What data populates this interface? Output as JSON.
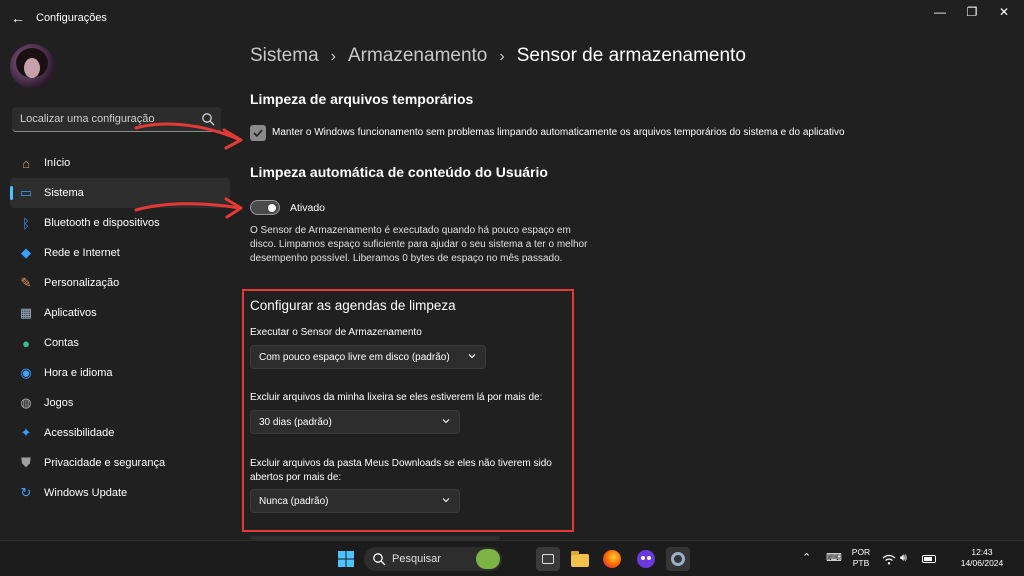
{
  "window": {
    "back_icon": "back-arrow-icon",
    "title": "Configurações",
    "controls": [
      "minimize-icon",
      "maximize-icon",
      "close-icon"
    ]
  },
  "sidebar": {
    "search_placeholder": "Localizar uma configuração",
    "items": [
      {
        "label": "Início",
        "icon": "home-icon",
        "color": "#e8a05c",
        "active": false
      },
      {
        "label": "Sistema",
        "icon": "monitor-icon",
        "color": "#3aa0ff",
        "active": true
      },
      {
        "label": "Bluetooth e dispositivos",
        "icon": "bluetooth-icon",
        "color": "#3aa0ff",
        "active": false
      },
      {
        "label": "Rede e Internet",
        "icon": "wifi-icon",
        "color": "#3aa0ff",
        "active": false
      },
      {
        "label": "Personalização",
        "icon": "brush-icon",
        "color": "#e8a05c",
        "active": false
      },
      {
        "label": "Aplicativos",
        "icon": "apps-icon",
        "color": "#9ab0c8",
        "active": false
      },
      {
        "label": "Contas",
        "icon": "person-icon",
        "color": "#3ac08a",
        "active": false
      },
      {
        "label": "Hora e idioma",
        "icon": "globe-clock-icon",
        "color": "#3aa0ff",
        "active": false
      },
      {
        "label": "Jogos",
        "icon": "gamepad-icon",
        "color": "#b0b0b0",
        "active": false
      },
      {
        "label": "Acessibilidade",
        "icon": "accessibility-icon",
        "color": "#3aa0ff",
        "active": false
      },
      {
        "label": "Privacidade e segurança",
        "icon": "shield-icon",
        "color": "#a0a0a0",
        "active": false
      },
      {
        "label": "Windows Update",
        "icon": "update-icon",
        "color": "#3aa0ff",
        "active": false
      }
    ]
  },
  "breadcrumb": {
    "items": [
      "Sistema",
      "Armazenamento"
    ],
    "current": "Sensor de armazenamento"
  },
  "temp_files": {
    "title": "Limpeza de arquivos temporários",
    "checked": true,
    "checkbox_label": "Manter o Windows funcionamento sem problemas limpando automaticamente os arquivos temporários do sistema e do aplicativo"
  },
  "auto_cleanup": {
    "title": "Limpeza automática de conteúdo do Usuário",
    "toggle_on": true,
    "toggle_label": "Ativado",
    "description": "O Sensor de Armazenamento é executado quando há pouco espaço em disco. Limpamos espaço suficiente para ajudar o seu sistema a ter o melhor desempenho possível. Liberamos 0 bytes de espaço no mês passado."
  },
  "schedule": {
    "title": "Configurar as agendas de limpeza",
    "run_label": "Executar o Sensor de Armazenamento",
    "run_value": "Com pouco espaço livre em disco (padrão)",
    "recycle_label": "Excluir arquivos da minha lixeira se eles estiverem lá por mais de:",
    "recycle_value": "30 dias (padrão)",
    "downloads_label": "Excluir arquivos da pasta Meus Downloads se eles não tiverem sido abertos por mais de:",
    "downloads_value": "Nunca (padrão)"
  },
  "taskbar": {
    "search_text": "Pesquisar",
    "lang_line1": "POR",
    "lang_line2": "PTB",
    "time": "12:43",
    "date": "14/06/2024",
    "icons": [
      "windows-start-icon",
      "search-icon",
      "task-view-icon",
      "file-explorer-icon",
      "firefox-icon",
      "app-icon",
      "settings-icon"
    ]
  },
  "colors": {
    "background": "#202020",
    "accent": "#4cc2ff",
    "annotation_red": "#e53935"
  }
}
